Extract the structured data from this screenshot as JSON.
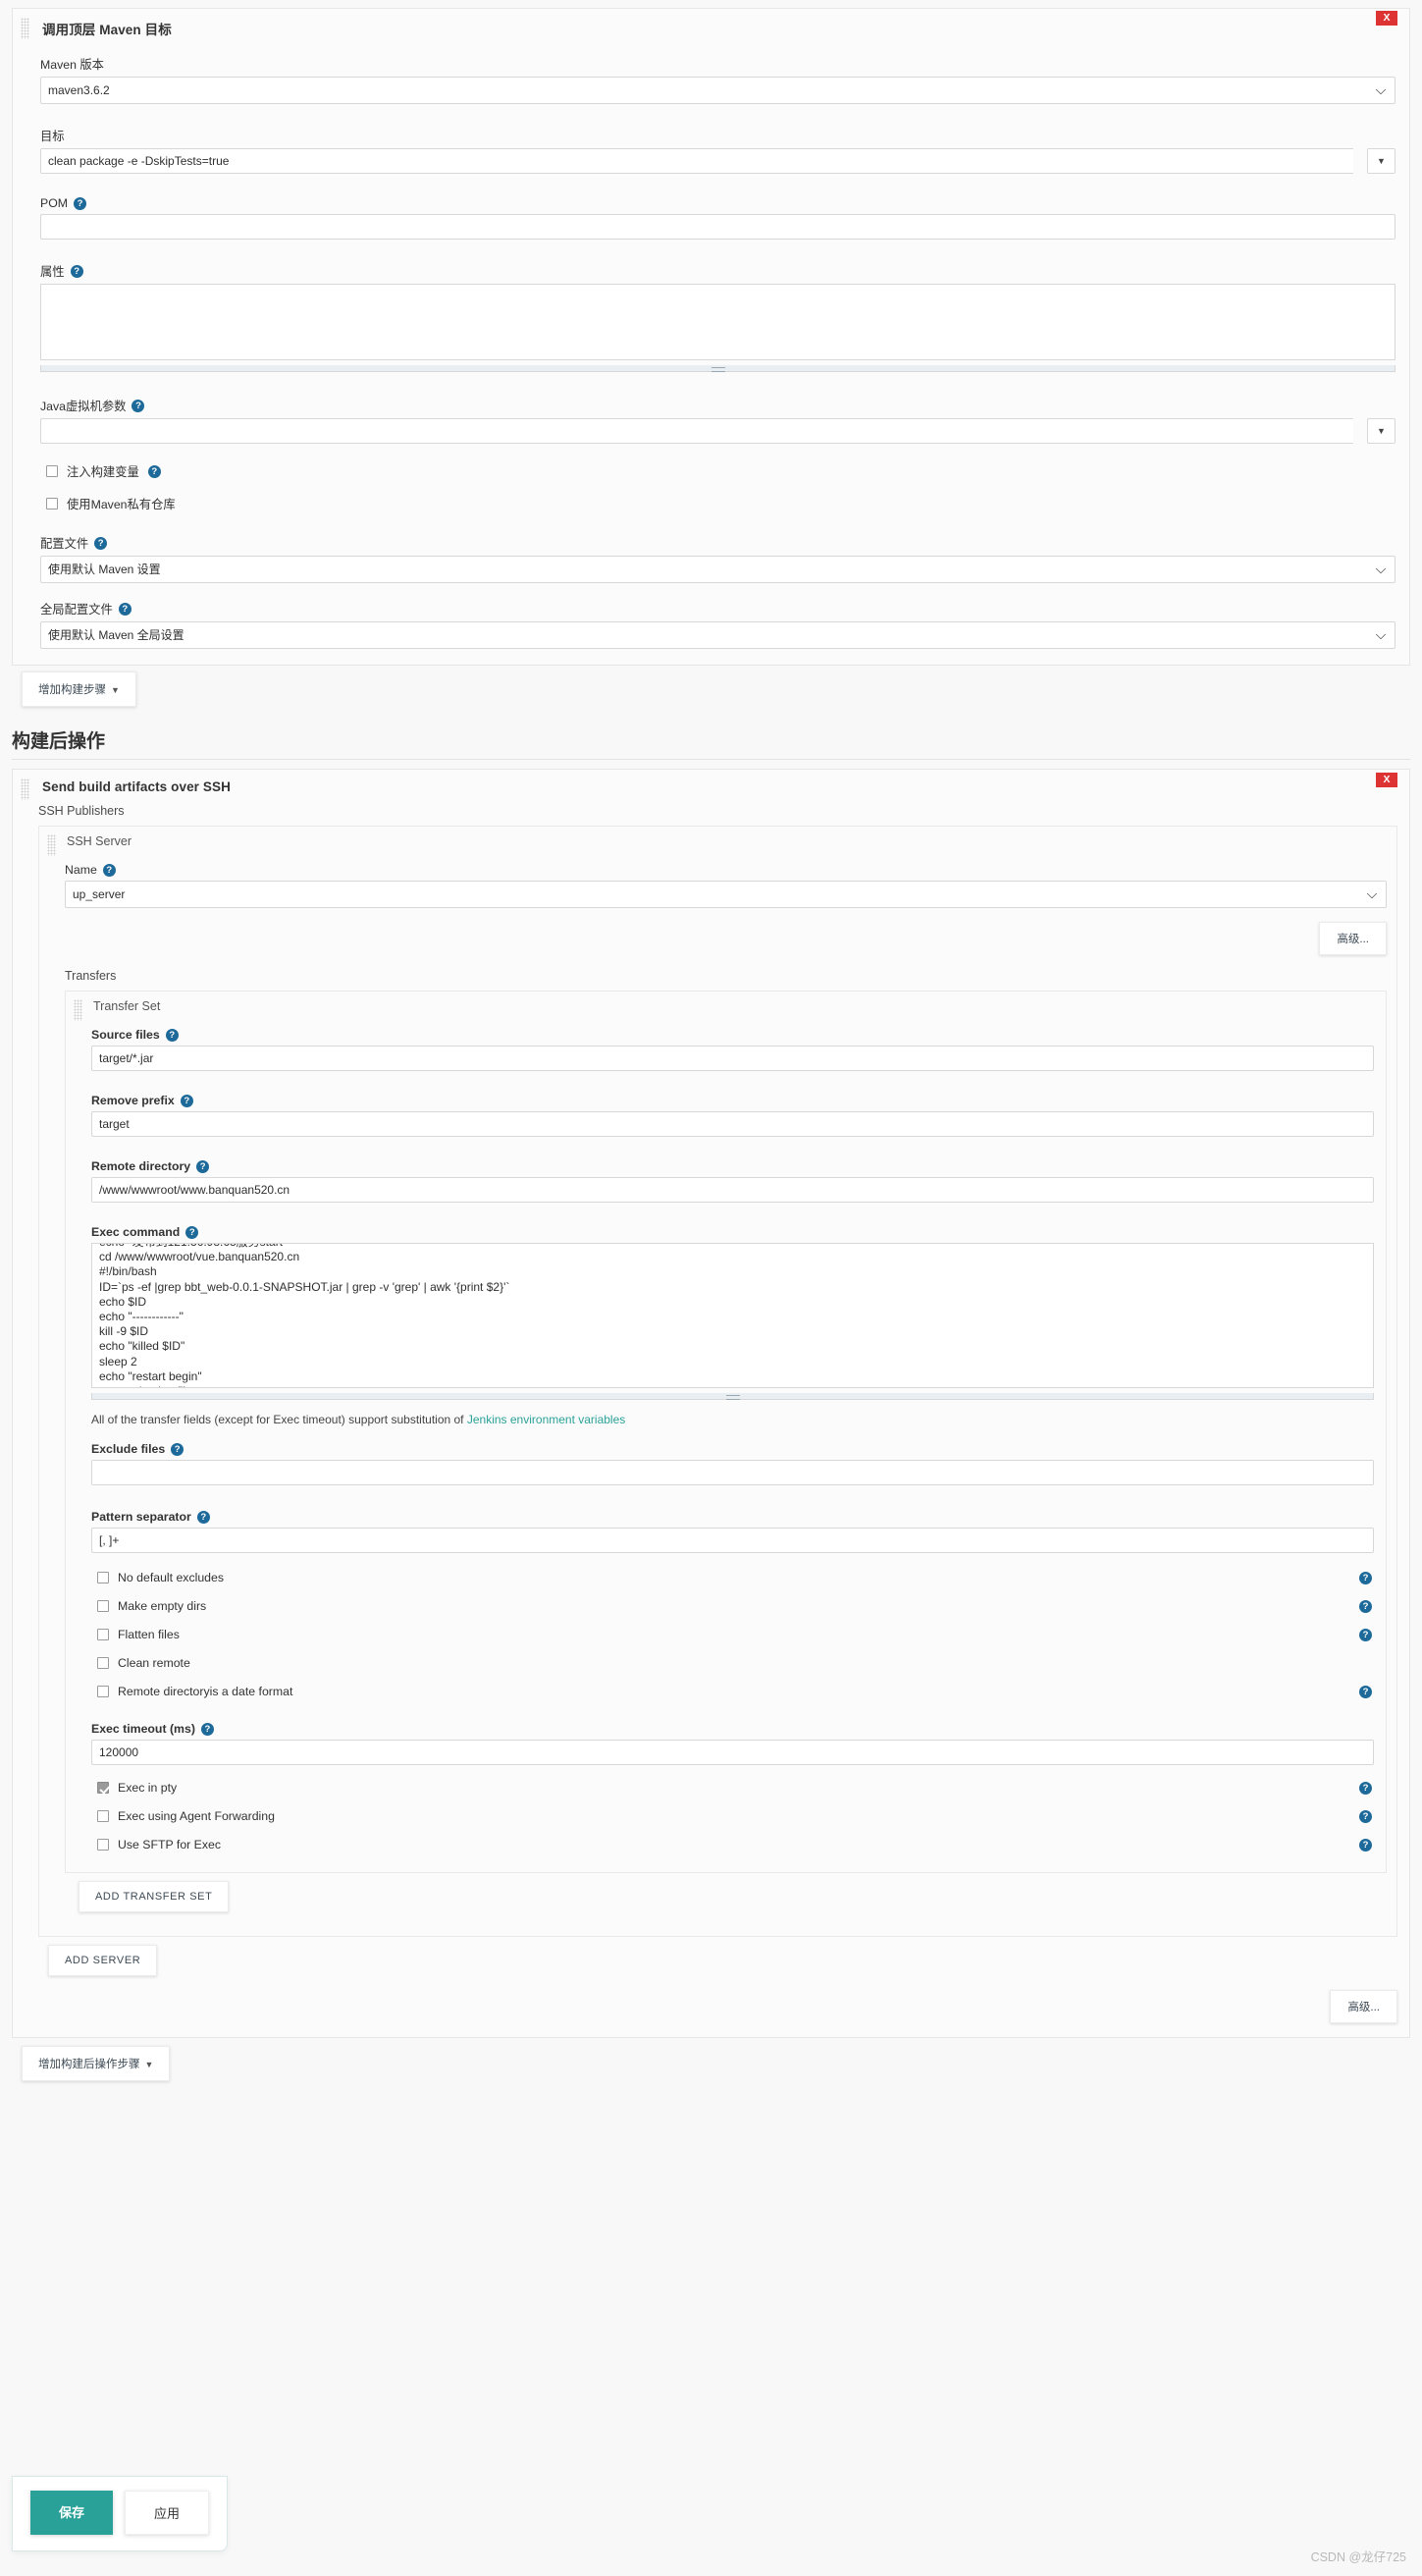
{
  "maven_step": {
    "title": "调用顶层 Maven 目标",
    "delete_label": "X",
    "maven_version_label": "Maven 版本",
    "maven_version_value": "maven3.6.2",
    "goals_label": "目标",
    "goals_value": "clean package -e -DskipTests=true",
    "pom_label": "POM",
    "pom_value": "",
    "properties_label": "属性",
    "properties_value": "",
    "jvm_label": "Java虚拟机参数",
    "jvm_value": "",
    "inject_vars_label": "注入构建变量",
    "inject_vars_checked": false,
    "private_repo_label": "使用Maven私有仓库",
    "private_repo_checked": false,
    "settings_label": "配置文件",
    "settings_value": "使用默认 Maven 设置",
    "global_settings_label": "全局配置文件",
    "global_settings_value": "使用默认 Maven 全局设置",
    "help_glyph": "?"
  },
  "add_build_step_button": "增加构建步骤",
  "post_build": {
    "heading": "构建后操作",
    "publisher_title": "Send build artifacts over SSH",
    "delete_label": "X",
    "ssh_publishers_label": "SSH Publishers",
    "ssh_server_label": "SSH Server",
    "name_label": "Name",
    "name_value": "up_server",
    "advanced_button": "高级...",
    "transfers_label": "Transfers",
    "transfer_set_label": "Transfer Set",
    "source_files_label": "Source files",
    "source_files_value": "target/*.jar",
    "remove_prefix_label": "Remove prefix",
    "remove_prefix_value": "target",
    "remote_directory_label": "Remote directory",
    "remote_directory_value": "/www/wwwroot/www.banquan520.cn",
    "exec_command_label": "Exec command",
    "exec_command_value": "echo \"发布到121.36.98.68服务start\"\ncd /www/wwwroot/vue.banquan520.cn\n#!/bin/bash\nID=`ps -ef |grep bbt_web-0.0.1-SNAPSHOT.jar | grep -v 'grep' | awk '{print $2}'`\necho $ID\necho \"------------\"\nkill -9 $ID\necho \"killed $ID\"\nsleep 2\necho \"restart begin\"\nsource /etc/profile\nnohup java -jar bbt_web-0.0.1-SNAPSHOT.jar > log/bbt_web.log 2>&1 &\nprocessID=`ps -ef |grep bbt_web-0.0.1-SNAPSHOT.jar | grep -v 'grep' | awk '{print $2}'`\necho \"restart success $processID\"\necho \"发布到121.36.98.68服务end\"",
    "hint_text_before": "All of the transfer fields (except for Exec timeout) support substitution of ",
    "hint_link": "Jenkins environment variables",
    "exclude_files_label": "Exclude files",
    "exclude_files_value": "",
    "pattern_separator_label": "Pattern separator",
    "pattern_separator_value": "[, ]+",
    "checkboxes": [
      {
        "label": "No default excludes",
        "checked": false,
        "help": true
      },
      {
        "label": "Make empty dirs",
        "checked": false,
        "help": true
      },
      {
        "label": "Flatten files",
        "checked": false,
        "help": true
      },
      {
        "label": "Clean remote",
        "checked": false,
        "help": false
      },
      {
        "label": "Remote directoryis a date format",
        "checked": false,
        "help": true
      }
    ],
    "exec_timeout_label": "Exec timeout (ms)",
    "exec_timeout_value": "120000",
    "checkboxes2": [
      {
        "label": "Exec in pty",
        "checked": true,
        "help": true
      },
      {
        "label": "Exec using Agent Forwarding",
        "checked": false,
        "help": true
      },
      {
        "label": "Use SFTP for Exec",
        "checked": false,
        "help": true
      }
    ],
    "add_transfer_set_button": "ADD TRANSFER SET",
    "add_server_button": "ADD SERVER",
    "advanced_button_bottom": "高级...",
    "add_post_build_step_button": "增加构建后操作步骤"
  },
  "footer": {
    "save_button": "保存",
    "apply_button": "应用",
    "watermark": "CSDN @龙仔725"
  },
  "icons": {
    "help": "?",
    "caret_down": "▼",
    "combo_caret": "▼"
  }
}
